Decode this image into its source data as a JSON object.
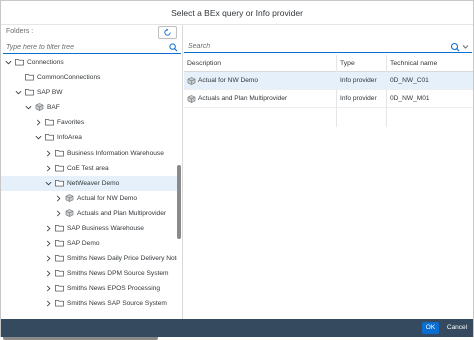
{
  "dialog": {
    "title": "Select a BEx query or Info provider"
  },
  "left": {
    "folders_label": "Folders :",
    "filter_placeholder": "Type here to filter tree"
  },
  "tree": [
    {
      "label": "Connections",
      "chevron": "down",
      "icon": "folder-icon"
    },
    {
      "label": "CommonConnections",
      "chevron": "none",
      "icon": "folder-icon"
    },
    {
      "label": "SAP BW",
      "chevron": "down",
      "icon": "folder-icon"
    },
    {
      "label": "BAF",
      "chevron": "down",
      "icon": "cube-icon"
    },
    {
      "label": "Favorites",
      "chevron": "right",
      "icon": "folder-icon"
    },
    {
      "label": "InfoArea",
      "chevron": "down",
      "icon": "folder-icon"
    },
    {
      "label": "Business Information Warehouse",
      "chevron": "right",
      "icon": "folder-icon"
    },
    {
      "label": "CoE Test area",
      "chevron": "right",
      "icon": "folder-icon"
    },
    {
      "label": "NetWeaver Demo",
      "chevron": "down",
      "icon": "folder-icon",
      "selected": true
    },
    {
      "label": "Actual for NW Demo",
      "chevron": "right",
      "icon": "cube-icon"
    },
    {
      "label": "Actuals and Plan Multiprovider",
      "chevron": "right",
      "icon": "cube-icon"
    },
    {
      "label": "SAP Business Warehouse",
      "chevron": "right",
      "icon": "folder-icon"
    },
    {
      "label": "SAP Demo",
      "chevron": "right",
      "icon": "folder-icon"
    },
    {
      "label": "Smiths News Daily Price Delivery Note",
      "chevron": "right",
      "icon": "folder-icon"
    },
    {
      "label": "Smiths News DPM Source System",
      "chevron": "right",
      "icon": "folder-icon"
    },
    {
      "label": "Smiths News EPOS Processing",
      "chevron": "right",
      "icon": "folder-icon"
    },
    {
      "label": "Smiths News SAP Source System",
      "chevron": "right",
      "icon": "folder-icon"
    }
  ],
  "right": {
    "search_placeholder": "Search",
    "columns": [
      "Description",
      "Type",
      "Technical name"
    ],
    "rows": [
      {
        "description": "Actual for NW Demo",
        "type": "Info provider",
        "technical_name": "0D_NW_C01",
        "icon": "cube-icon",
        "selected": true
      },
      {
        "description": "Actuals and Plan Multiprovider",
        "type": "Info provider",
        "technical_name": "0D_NW_M01",
        "icon": "cube-icon"
      }
    ]
  },
  "footer": {
    "ok_label": "OK",
    "cancel_label": "Cancel"
  },
  "colors": {
    "accent": "#0a6ed1",
    "footer_bg": "#354a5f",
    "selection": "#e5f0fa"
  }
}
